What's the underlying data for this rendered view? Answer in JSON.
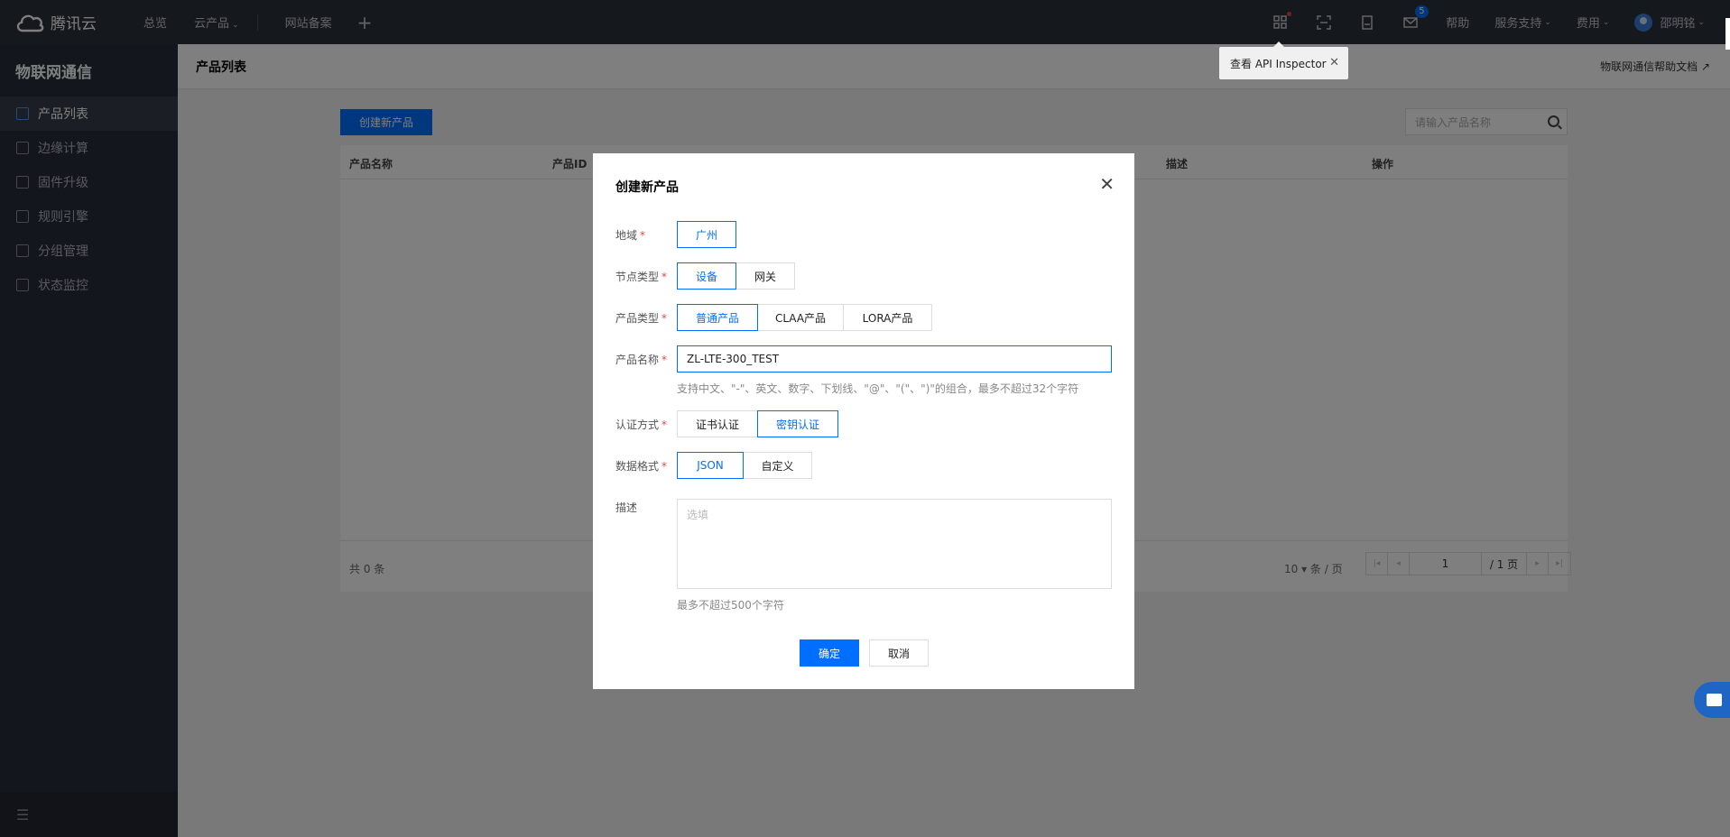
{
  "topnav": {
    "brand": "腾讯云",
    "links": [
      "总览",
      "云产品",
      "网站备案"
    ],
    "plus": "+",
    "mail_badge": "5",
    "help": "帮助",
    "service": "服务支持",
    "billing": "费用",
    "user": "邵明铭"
  },
  "sidebar": {
    "title": "物联网通信",
    "items": [
      {
        "label": "产品列表",
        "icon": "list-icon"
      },
      {
        "label": "边缘计算",
        "icon": "edge-icon"
      },
      {
        "label": "固件升级",
        "icon": "firmware-icon"
      },
      {
        "label": "规则引擎",
        "icon": "rule-icon"
      },
      {
        "label": "分组管理",
        "icon": "group-icon"
      },
      {
        "label": "状态监控",
        "icon": "monitor-icon"
      }
    ],
    "collapse_icon": "collapse-icon"
  },
  "main": {
    "title": "产品列表",
    "help_doc": "物联网通信帮助文档 ↗",
    "create_button": "创建新产品",
    "search_placeholder": "请输入产品名称",
    "table": {
      "headers": [
        "产品名称",
        "产品ID",
        "描述",
        "操作"
      ],
      "total": "共 0 条",
      "per_page": "10 ▾  条 / 页",
      "page": "1",
      "page_total": "/ 1 页"
    }
  },
  "api_tip": {
    "label": "查看 API Inspector",
    "close": "✕"
  },
  "modal": {
    "title": "创建新产品",
    "close": "✕",
    "region": {
      "label": "地域",
      "options": [
        "广州"
      ]
    },
    "node_type": {
      "label": "节点类型",
      "options": [
        "设备",
        "网关"
      ]
    },
    "product_type": {
      "label": "产品类型",
      "options": [
        "普通产品",
        "CLAA产品",
        "LORA产品"
      ]
    },
    "product_name": {
      "label": "产品名称",
      "value": "ZL-LTE-300_TEST",
      "hint": "支持中文、\"-\"、英文、数字、下划线、\"@\"、\"(\"、\")\"的组合，最多不超过32个字符"
    },
    "auth": {
      "label": "认证方式",
      "options": [
        "证书认证",
        "密钥认证"
      ]
    },
    "data_format": {
      "label": "数据格式",
      "options": [
        "JSON",
        "自定义"
      ]
    },
    "description": {
      "label": "描述",
      "placeholder": "选填",
      "hint": "最多不超过500个字符"
    },
    "required_mark": "*",
    "ok": "确定",
    "cancel": "取消"
  },
  "colors": {
    "accent": "#006eff",
    "topnav_bg": "#2b303b",
    "sidebar_bg": "#292d3b",
    "required": "#e54545"
  }
}
